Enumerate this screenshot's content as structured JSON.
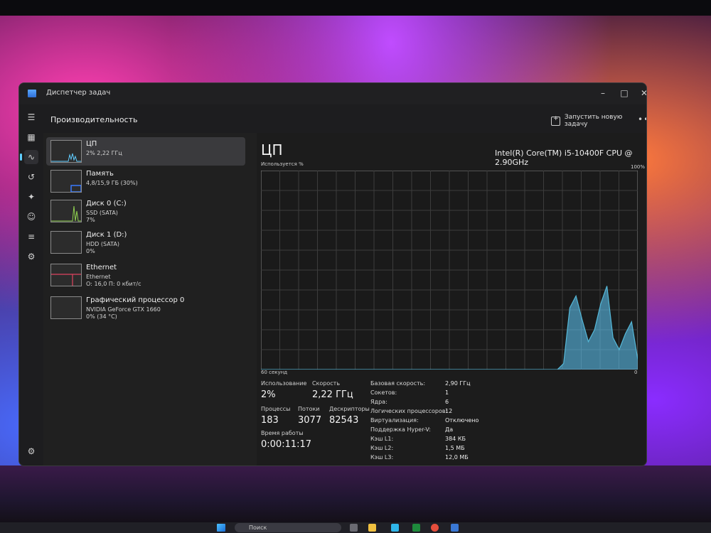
{
  "window": {
    "title": "Диспетчер задач",
    "page_title": "Производительность",
    "run_task_label": "Запустить новую задачу",
    "more_label": "•••"
  },
  "sidebar": {
    "items": [
      {
        "name": "ЦП",
        "sub1": "2% 2,22 ГГц",
        "sub2": "",
        "selected": true,
        "thumb_color": "#60cdff"
      },
      {
        "name": "Память",
        "sub1": "4,8/15,9 ГБ (30%)",
        "sub2": "",
        "selected": false,
        "thumb_color": "#3a7bff"
      },
      {
        "name": "Диск 0 (C:)",
        "sub1": "SSD (SATA)",
        "sub2": "7%",
        "selected": false,
        "thumb_color": "#8fd14f"
      },
      {
        "name": "Диск 1 (D:)",
        "sub1": "HDD (SATA)",
        "sub2": "0%",
        "selected": false,
        "thumb_color": "#8fd14f"
      },
      {
        "name": "Ethernet",
        "sub1": "Ethernet",
        "sub2": "О: 16,0 П: 0 кбит/с",
        "selected": false,
        "thumb_color": "#e0435f"
      },
      {
        "name": "Графический процессор 0",
        "sub1": "NVIDIA GeForce GTX 1660",
        "sub2": "0% (34 °C)",
        "selected": false,
        "thumb_color": "#60cdff"
      }
    ]
  },
  "main": {
    "heading": "ЦП",
    "cpu_model": "Intel(R) Core(TM) i5-10400F CPU @ 2.90GHz",
    "usage_label": "Используется %",
    "max_label": "100%",
    "time_label": "60 секунд",
    "min_label": "0",
    "stats": {
      "usage_label": "Использование",
      "usage_value": "2%",
      "speed_label": "Скорость",
      "speed_value": "2,22 ГГц",
      "processes_label": "Процессы",
      "processes_value": "183",
      "threads_label": "Потоки",
      "threads_value": "3077",
      "handles_label": "Дескрипторы",
      "handles_value": "82543",
      "uptime_label": "Время работы",
      "uptime_value": "0:00:11:17"
    },
    "specs": [
      {
        "k": "Базовая скорость:",
        "v": "2,90 ГГц"
      },
      {
        "k": "Сокетов:",
        "v": "1"
      },
      {
        "k": "Ядра:",
        "v": "6"
      },
      {
        "k": "Логических процессоров:",
        "v": "12"
      },
      {
        "k": "Виртуализация:",
        "v": "Отключено"
      },
      {
        "k": "Поддержка Hyper-V:",
        "v": "Да"
      },
      {
        "k": "Кэш L1:",
        "v": "384 КБ"
      },
      {
        "k": "Кэш L2:",
        "v": "1,5 МБ"
      },
      {
        "k": "Кэш L3:",
        "v": "12,0 МБ"
      }
    ]
  },
  "chart_data": {
    "type": "area",
    "ylim": [
      0,
      100
    ],
    "xlabel": "60 секунд",
    "ylabel": "Используется %",
    "grid": true,
    "color": "#60cdff",
    "values": [
      0,
      0,
      0,
      0,
      0,
      0,
      0,
      0,
      0,
      0,
      0,
      0,
      0,
      0,
      0,
      0,
      0,
      0,
      0,
      0,
      0,
      0,
      0,
      0,
      0,
      0,
      0,
      0,
      0,
      0,
      0,
      0,
      0,
      0,
      0,
      0,
      0,
      0,
      0,
      0,
      0,
      0,
      0,
      0,
      0,
      0,
      0,
      0,
      0,
      3,
      31,
      37,
      25,
      14,
      20,
      33,
      42,
      16,
      10,
      18,
      24,
      5
    ]
  },
  "taskbar": {
    "search_label": "Поиск"
  },
  "colors": {
    "accent": "#60cdff",
    "window_bg": "#1d1d1f",
    "graph_line": "#55b8d8"
  }
}
